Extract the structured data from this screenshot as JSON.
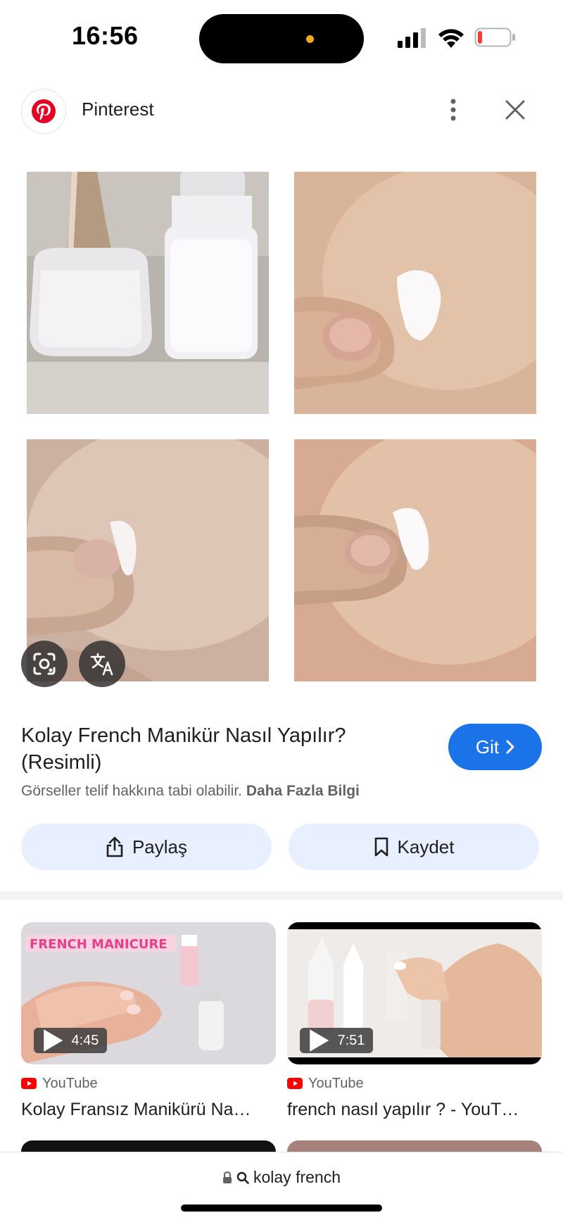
{
  "status_bar": {
    "time": "16:56",
    "icons": [
      "signal-icon",
      "wifi-icon",
      "battery-low-icon"
    ]
  },
  "header": {
    "site_name": "Pinterest",
    "logo_icon": "pinterest-logo",
    "brand_color": "#e60023"
  },
  "image_overlay": {
    "lens_icon": "lens-icon",
    "translate_icon": "translate-icon"
  },
  "result": {
    "title": "Kolay French Manikür Nasıl Yapılır? (Resimli)",
    "go_label": "Git",
    "copyright_text": "Görseller telif hakkına tabi olabilir.",
    "more_info_label": "Daha Fazla Bilgi",
    "share_label": "Paylaş",
    "save_label": "Kaydet",
    "accent_color": "#1a73e8"
  },
  "related": [
    {
      "duration": "4:45",
      "source": "YouTube",
      "title": "Kolay Fransız Manikürü Na…",
      "thumb_text": "FRENCH MANICURE"
    },
    {
      "duration": "7:51",
      "source": "YouTube",
      "title": "french nasıl yapılır ? - YouT…"
    }
  ],
  "bottom_bar": {
    "query": "kolay french"
  }
}
